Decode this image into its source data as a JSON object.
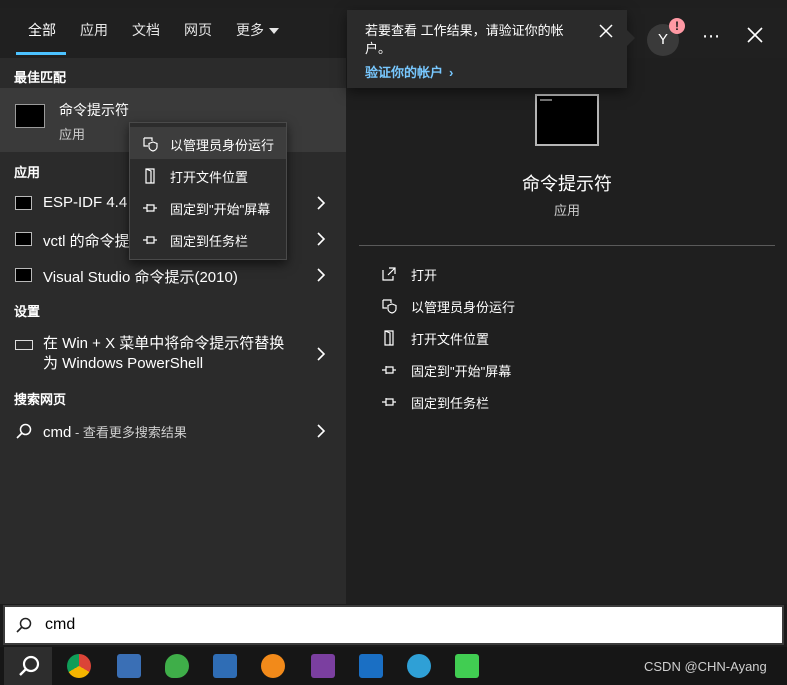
{
  "tabs": [
    {
      "label": "全部",
      "active": true
    },
    {
      "label": "应用"
    },
    {
      "label": "文档"
    },
    {
      "label": "网页"
    },
    {
      "label": "更多"
    }
  ],
  "account": {
    "avatar_letter": "Y",
    "badge": "!"
  },
  "toast": {
    "message": "若要查看 工作结果，请验证你的帐户。",
    "link": "验证你的帐户"
  },
  "left": {
    "best_match_header": "最佳匹配",
    "best_match": {
      "title": "命令提示符",
      "subtitle": "应用"
    },
    "apps_header": "应用",
    "apps": [
      {
        "label": "ESP-IDF 4.4 CMD"
      },
      {
        "label": "vctl 的命令提示符"
      },
      {
        "label": "Visual Studio 命令提示(2010)"
      }
    ],
    "settings_header": "设置",
    "setting": {
      "label": "在 Win + X 菜单中将命令提示符替换为 Windows PowerShell"
    },
    "web_header": "搜索网页",
    "web": {
      "query": "cmd",
      "suffix": " - 查看更多搜索结果"
    }
  },
  "context_menu": [
    {
      "label": "以管理员身份运行",
      "icon": "shield-icon",
      "hover": true
    },
    {
      "label": "打开文件位置",
      "icon": "folder-icon"
    },
    {
      "label": "固定到\"开始\"屏幕",
      "icon": "pin-icon"
    },
    {
      "label": "固定到任务栏",
      "icon": "pin-icon"
    }
  ],
  "detail": {
    "title": "命令提示符",
    "subtitle": "应用",
    "actions": [
      {
        "label": "打开",
        "icon": "open-icon"
      },
      {
        "label": "以管理员身份运行",
        "icon": "shield-icon"
      },
      {
        "label": "打开文件位置",
        "icon": "folder-icon"
      },
      {
        "label": "固定到\"开始\"屏幕",
        "icon": "pin-icon"
      },
      {
        "label": "固定到任务栏",
        "icon": "pin-icon"
      }
    ]
  },
  "search": {
    "value": "cmd"
  },
  "taskbar": {
    "apps": [
      {
        "name": "search-icon",
        "color": "#161616"
      },
      {
        "name": "chrome-icon",
        "color": "#db4437"
      },
      {
        "name": "remote-desktop-icon",
        "color": "#3a6fb5"
      },
      {
        "name": "clover-icon",
        "color": "#3fae49"
      },
      {
        "name": "calculator-icon",
        "color": "#2f6db5"
      },
      {
        "name": "magnifier-tool-icon",
        "color": "#f28a1a"
      },
      {
        "name": "onenote-icon",
        "color": "#7b3fa0"
      },
      {
        "name": "outlook-icon",
        "color": "#1a6fc4"
      },
      {
        "name": "browser-icon",
        "color": "#2fa0d6"
      },
      {
        "name": "qt-icon",
        "color": "#41cd52"
      }
    ],
    "watermark": "CSDN @CHN-Ayang"
  }
}
